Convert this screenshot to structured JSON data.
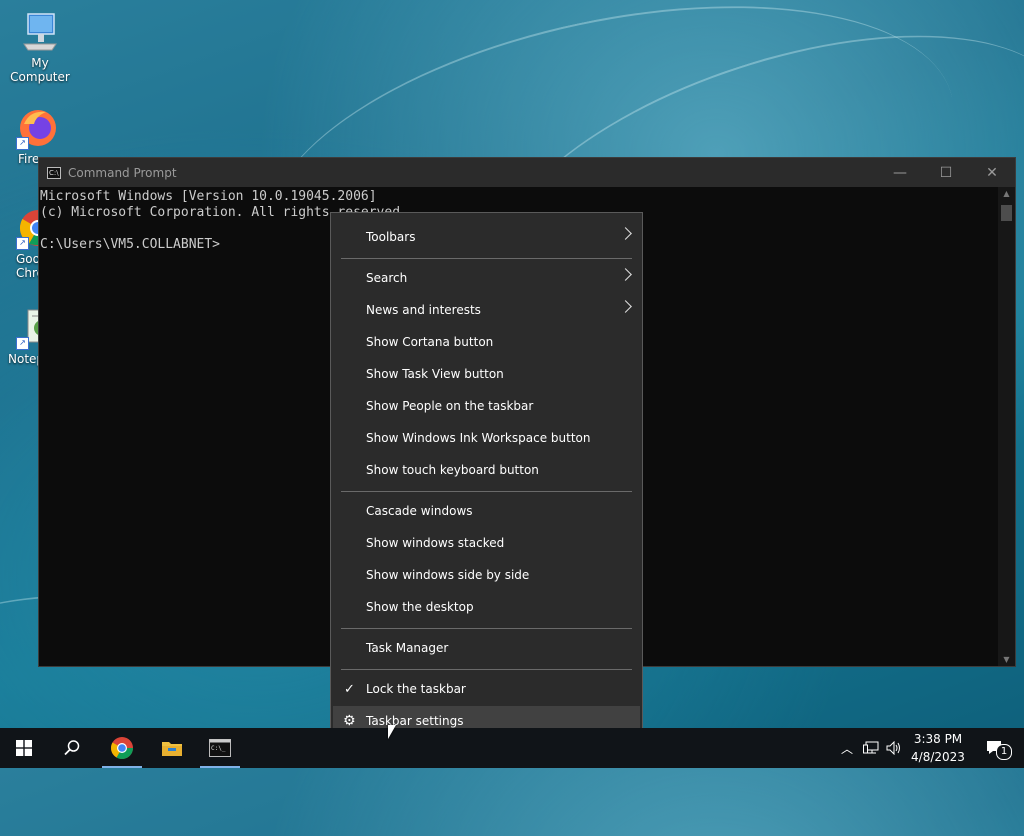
{
  "desktop": {
    "icons": [
      {
        "label": "My Computer"
      },
      {
        "label": "Fire"
      },
      {
        "label": "Goo Chro"
      },
      {
        "label": "Notep"
      }
    ]
  },
  "cmd_window": {
    "title": "Command Prompt",
    "lines": [
      "Microsoft Windows [Version 10.0.19045.2006]",
      "(c) Microsoft Corporation. All rights reserved.",
      "",
      "C:\\Users\\VM5.COLLABNET>"
    ]
  },
  "context_menu": {
    "items": [
      {
        "label": "Toolbars",
        "submenu": true
      },
      {
        "label": "Search",
        "submenu": true
      },
      {
        "label": "News and interests",
        "submenu": true
      },
      {
        "label": "Show Cortana button"
      },
      {
        "label": "Show Task View button"
      },
      {
        "label": "Show People on the taskbar"
      },
      {
        "label": "Show Windows Ink Workspace button"
      },
      {
        "label": "Show touch keyboard button"
      },
      {
        "label": "Cascade windows"
      },
      {
        "label": "Show windows stacked"
      },
      {
        "label": "Show windows side by side"
      },
      {
        "label": "Show the desktop"
      },
      {
        "label": "Task Manager"
      },
      {
        "label": "Lock the taskbar",
        "checked": true
      },
      {
        "label": "Taskbar settings",
        "icon": "gear-icon",
        "highlighted": true
      }
    ]
  },
  "taskbar": {
    "items": [
      "start-icon",
      "search-icon",
      "chrome-icon",
      "file-explorer-icon",
      "command-prompt-icon"
    ],
    "time": "3:38 PM",
    "date": "4/8/2023",
    "notification_count": "1"
  },
  "colors": {
    "menu_bg": "#2b2b2b",
    "menu_highlight": "#414141",
    "taskbar_bg": "#101418",
    "active_indicator": "#7fb2e8"
  }
}
